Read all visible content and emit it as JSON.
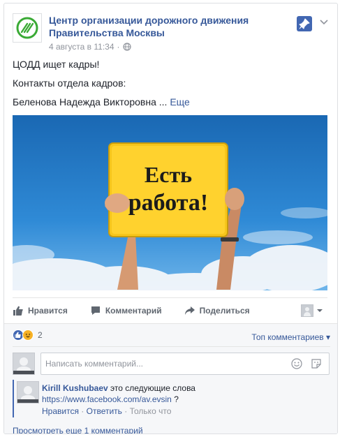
{
  "post": {
    "page_name": "Центр организации дорожного движения Правительства Москвы",
    "timestamp": "4 августа в 11:34",
    "separator": "·",
    "lines": [
      "ЦОДД ищет кадры!",
      "Контакты отдела кадров:",
      "Беленова Надежда Викторовна ..."
    ],
    "more_label": "Еще",
    "image": {
      "sign_line1": "Есть",
      "sign_line2": "работа!"
    }
  },
  "actions": {
    "like": "Нравится",
    "comment": "Комментарий",
    "share": "Поделиться"
  },
  "reactions": {
    "count": "2",
    "sort_label": "Топ комментариев ▾"
  },
  "comment_box": {
    "placeholder": "Написать комментарий..."
  },
  "comment": {
    "author": "Kirill Kushubaev",
    "text": "это следующие слова",
    "link": "https://www.facebook.com/av.evsin",
    "suffix": "?",
    "like": "Нравится",
    "reply": "Ответить",
    "time": "Только что",
    "dot": "·"
  },
  "view_more": "Просмотреть еще 1 комментарий",
  "colors": {
    "link": "#365899",
    "accent": "#4267b2",
    "sign": "#f7c61b",
    "sky": "#1f78c4"
  },
  "icons": {
    "logo": "codd-logo-icon",
    "globe": "globe-icon",
    "pin": "pin-icon",
    "chevron": "chevron-down-icon",
    "like": "thumbs-up-icon",
    "comment": "speech-bubble-icon",
    "share": "share-arrow-icon",
    "emoji": "smiley-icon",
    "sticker": "sticker-icon"
  }
}
